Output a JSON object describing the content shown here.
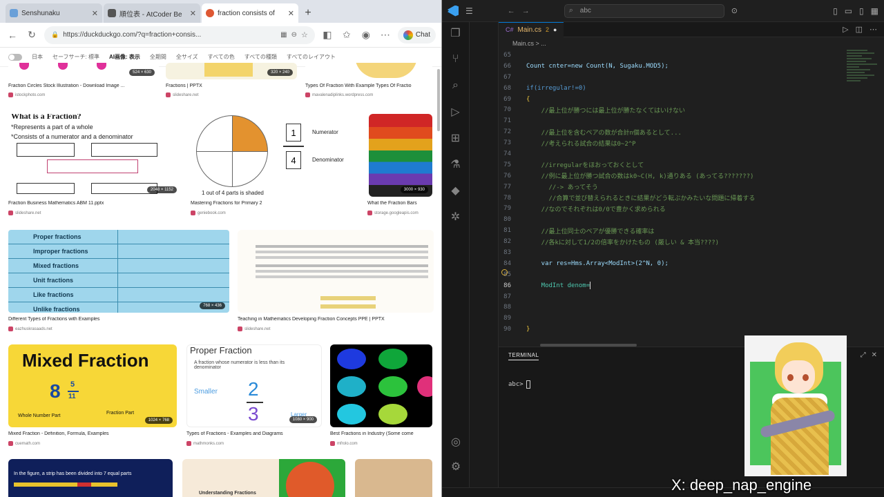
{
  "browser": {
    "tabs": [
      {
        "title": "Senshunaku",
        "active": false
      },
      {
        "title": "順位表 - AtCoder Be",
        "active": false
      },
      {
        "title": "fraction consists of",
        "active": true
      }
    ],
    "new_tab": "+",
    "url": "https://duckduckgo.com/?q=fraction+consis...",
    "chat_label": "Chat",
    "filters": [
      "日本",
      "セーフサーチ: 標準",
      "AI画像: 表示",
      "全期間",
      "全サイズ",
      "すべての色",
      "すべての種類",
      "すべてのレイアウト"
    ],
    "results": [
      {
        "caption": "Fraction Circles Stock Illustration - Download Image ...",
        "source": "istockphoto.com",
        "dims": "524 × 630"
      },
      {
        "caption": "Fractions | PPTX",
        "source": "slideshare.net",
        "dims": "320 × 240"
      },
      {
        "caption": "Types Of Fraction With Example Types Of Fractio",
        "source": "mavalenadiplinks.wordpress.com",
        "dims": ""
      },
      {
        "caption": "Fraction Business Mathematics ABM 11.pptx",
        "source": "slideshare.net",
        "dims": "2048 × 1152"
      },
      {
        "caption": "Mastering Fractions for Primary 2",
        "source": "geniebook.com",
        "dims": ""
      },
      {
        "caption": "What the Fraction Bars",
        "source": "storage.googleapis.com",
        "dims": "3000 × 930"
      },
      {
        "caption": "Different Types of Fractions with Examples",
        "source": "eazhuskrasaads.net",
        "dims": "768 × 436"
      },
      {
        "caption": "Teaching in Mathematics Developing Fraction Concepts PPE | PPTX",
        "source": "slideshare.net",
        "dims": ""
      },
      {
        "caption": "Mixed Fraction - Definition, Formula, Examples",
        "source": "cuemath.com",
        "dims": "1024 × 768"
      },
      {
        "caption": "Types of Fractions - Examples and Diagrams",
        "source": "mathmonks.com",
        "dims": "1080 × 900"
      },
      {
        "caption": "Best Fractions in Industry (Some come",
        "source": "mfrolo.com",
        "dims": ""
      }
    ],
    "thumb_text": {
      "what_is_fraction": "What is a Fraction?",
      "represents": "*Represents a part of a whole",
      "consists": "*Consists of a numerator and a denominator",
      "numerator_label": "Numerator",
      "denominator_label": "Denominator",
      "one": "1",
      "four": "4",
      "one_of_four": "1 out of 4 parts is shaded",
      "table_rows": [
        "Proper fractions",
        "Improper fractions",
        "Mixed fractions",
        "Unit fractions",
        "Like fractions",
        "Unlike fractions"
      ],
      "mixed_title": "Mixed Fraction",
      "mixed_whole": "8",
      "mixed_num": "5",
      "mixed_den": "11",
      "whole_number_part": "Whole Number Part",
      "fraction_part": "Fraction Part",
      "proper_title": "Proper Fraction",
      "proper_desc": "A fraction whose numerator is less than its denominator",
      "smaller": "Smaller",
      "larger": "Larger",
      "proper_num": "2",
      "proper_den": "3",
      "understanding": "Understanding Fractions",
      "strip_text": "In the figure, a strip has been divided into 7 equal parts"
    }
  },
  "vscode": {
    "search": "abc",
    "tab": {
      "name": "Main.cs",
      "problems": "2",
      "modified": "●"
    },
    "breadcrumb": "Main.cs  >  ...",
    "lines": [
      {
        "n": "65",
        "text": ""
      },
      {
        "n": "66",
        "text": "Count cnter=new Count(N, Sugaku.MOD5);"
      },
      {
        "n": "67",
        "text": ""
      },
      {
        "n": "68",
        "text": "if(irregular!=0)"
      },
      {
        "n": "69",
        "text": "{"
      },
      {
        "n": "70",
        "text": "    //最上位が勝つには最上位が勝たなくてはいけない"
      },
      {
        "n": "71",
        "text": ""
      },
      {
        "n": "72",
        "text": "    //最上位を含むペアの数が合計n個あるとして..."
      },
      {
        "n": "73",
        "text": "    //考えられる試合の結果は0~2^P"
      },
      {
        "n": "74",
        "text": ""
      },
      {
        "n": "75",
        "text": "    //irregularをほおっておくとして"
      },
      {
        "n": "76",
        "text": "    //例に最上位が勝つ試合の数はk0~C(H, k)通りある (あってる???????)"
      },
      {
        "n": "77",
        "text": "      //-> あってそう"
      },
      {
        "n": "78",
        "text": "      //合算で並び替えられるときに結果がどう転ぶかみたいな問題に帰着する"
      },
      {
        "n": "79",
        "text": "    //なのでそれぞれは0/0で豊かく求められる"
      },
      {
        "n": "80",
        "text": ""
      },
      {
        "n": "81",
        "text": "    //最上位同士のペアが優勝できる確率は"
      },
      {
        "n": "82",
        "text": "    //各kに対して1/2の倍率をかけたもの (厳しい & 本当????)"
      },
      {
        "n": "83",
        "text": ""
      },
      {
        "n": "84",
        "text": "    var res=Hms.Array<ModInt>(2^N, 0);"
      },
      {
        "n": "85",
        "text": ""
      },
      {
        "n": "86",
        "text": "    ModInt denom="
      },
      {
        "n": "87",
        "text": ""
      },
      {
        "n": "88",
        "text": ""
      },
      {
        "n": "89",
        "text": ""
      },
      {
        "n": "90",
        "text": "}"
      }
    ],
    "terminal_tab": "TERMINAL",
    "terminal_prompt": "abc>"
  },
  "overlay": {
    "handle": "X: deep_nap_engine"
  }
}
